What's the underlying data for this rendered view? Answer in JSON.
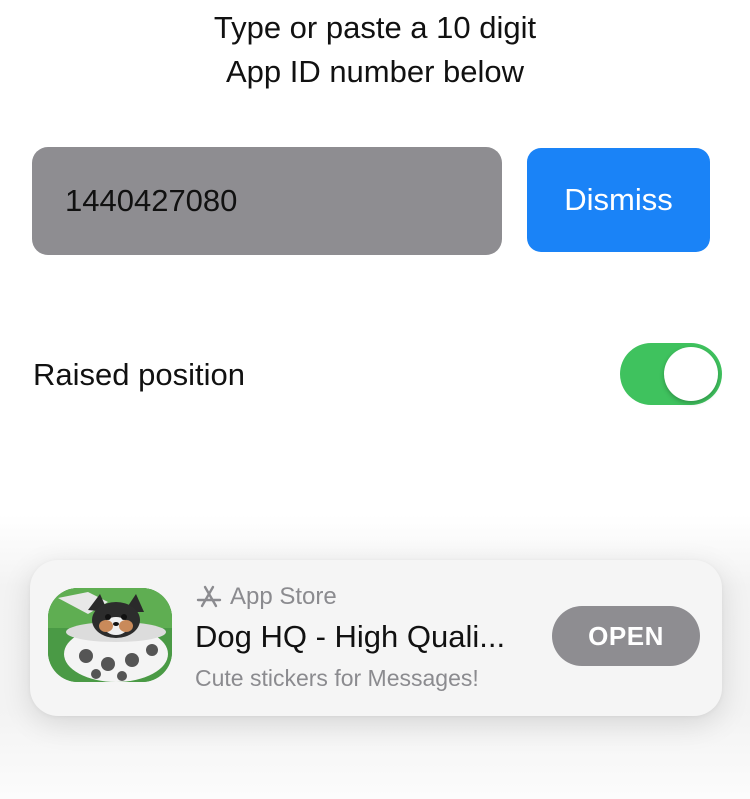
{
  "instructions": {
    "line1": "Type or paste a 10 digit",
    "line2": "App ID number below"
  },
  "app_id_input": {
    "value": "1440427080"
  },
  "dismiss_button": {
    "label": "Dismiss"
  },
  "raised_position": {
    "label": "Raised position",
    "enabled": true
  },
  "app_banner": {
    "store_label": "App Store",
    "store_icon": "app-store-icon",
    "app_name": "Dog HQ - High Quali...",
    "subtitle": "Cute stickers for Messages!",
    "action_label": "OPEN",
    "icon": "dog-in-cup-app-icon"
  },
  "colors": {
    "accent_blue": "#1a83f7",
    "toggle_on_green": "#3fc25e",
    "field_gray": "#8e8d91",
    "secondary_text": "#8b8b8f"
  }
}
